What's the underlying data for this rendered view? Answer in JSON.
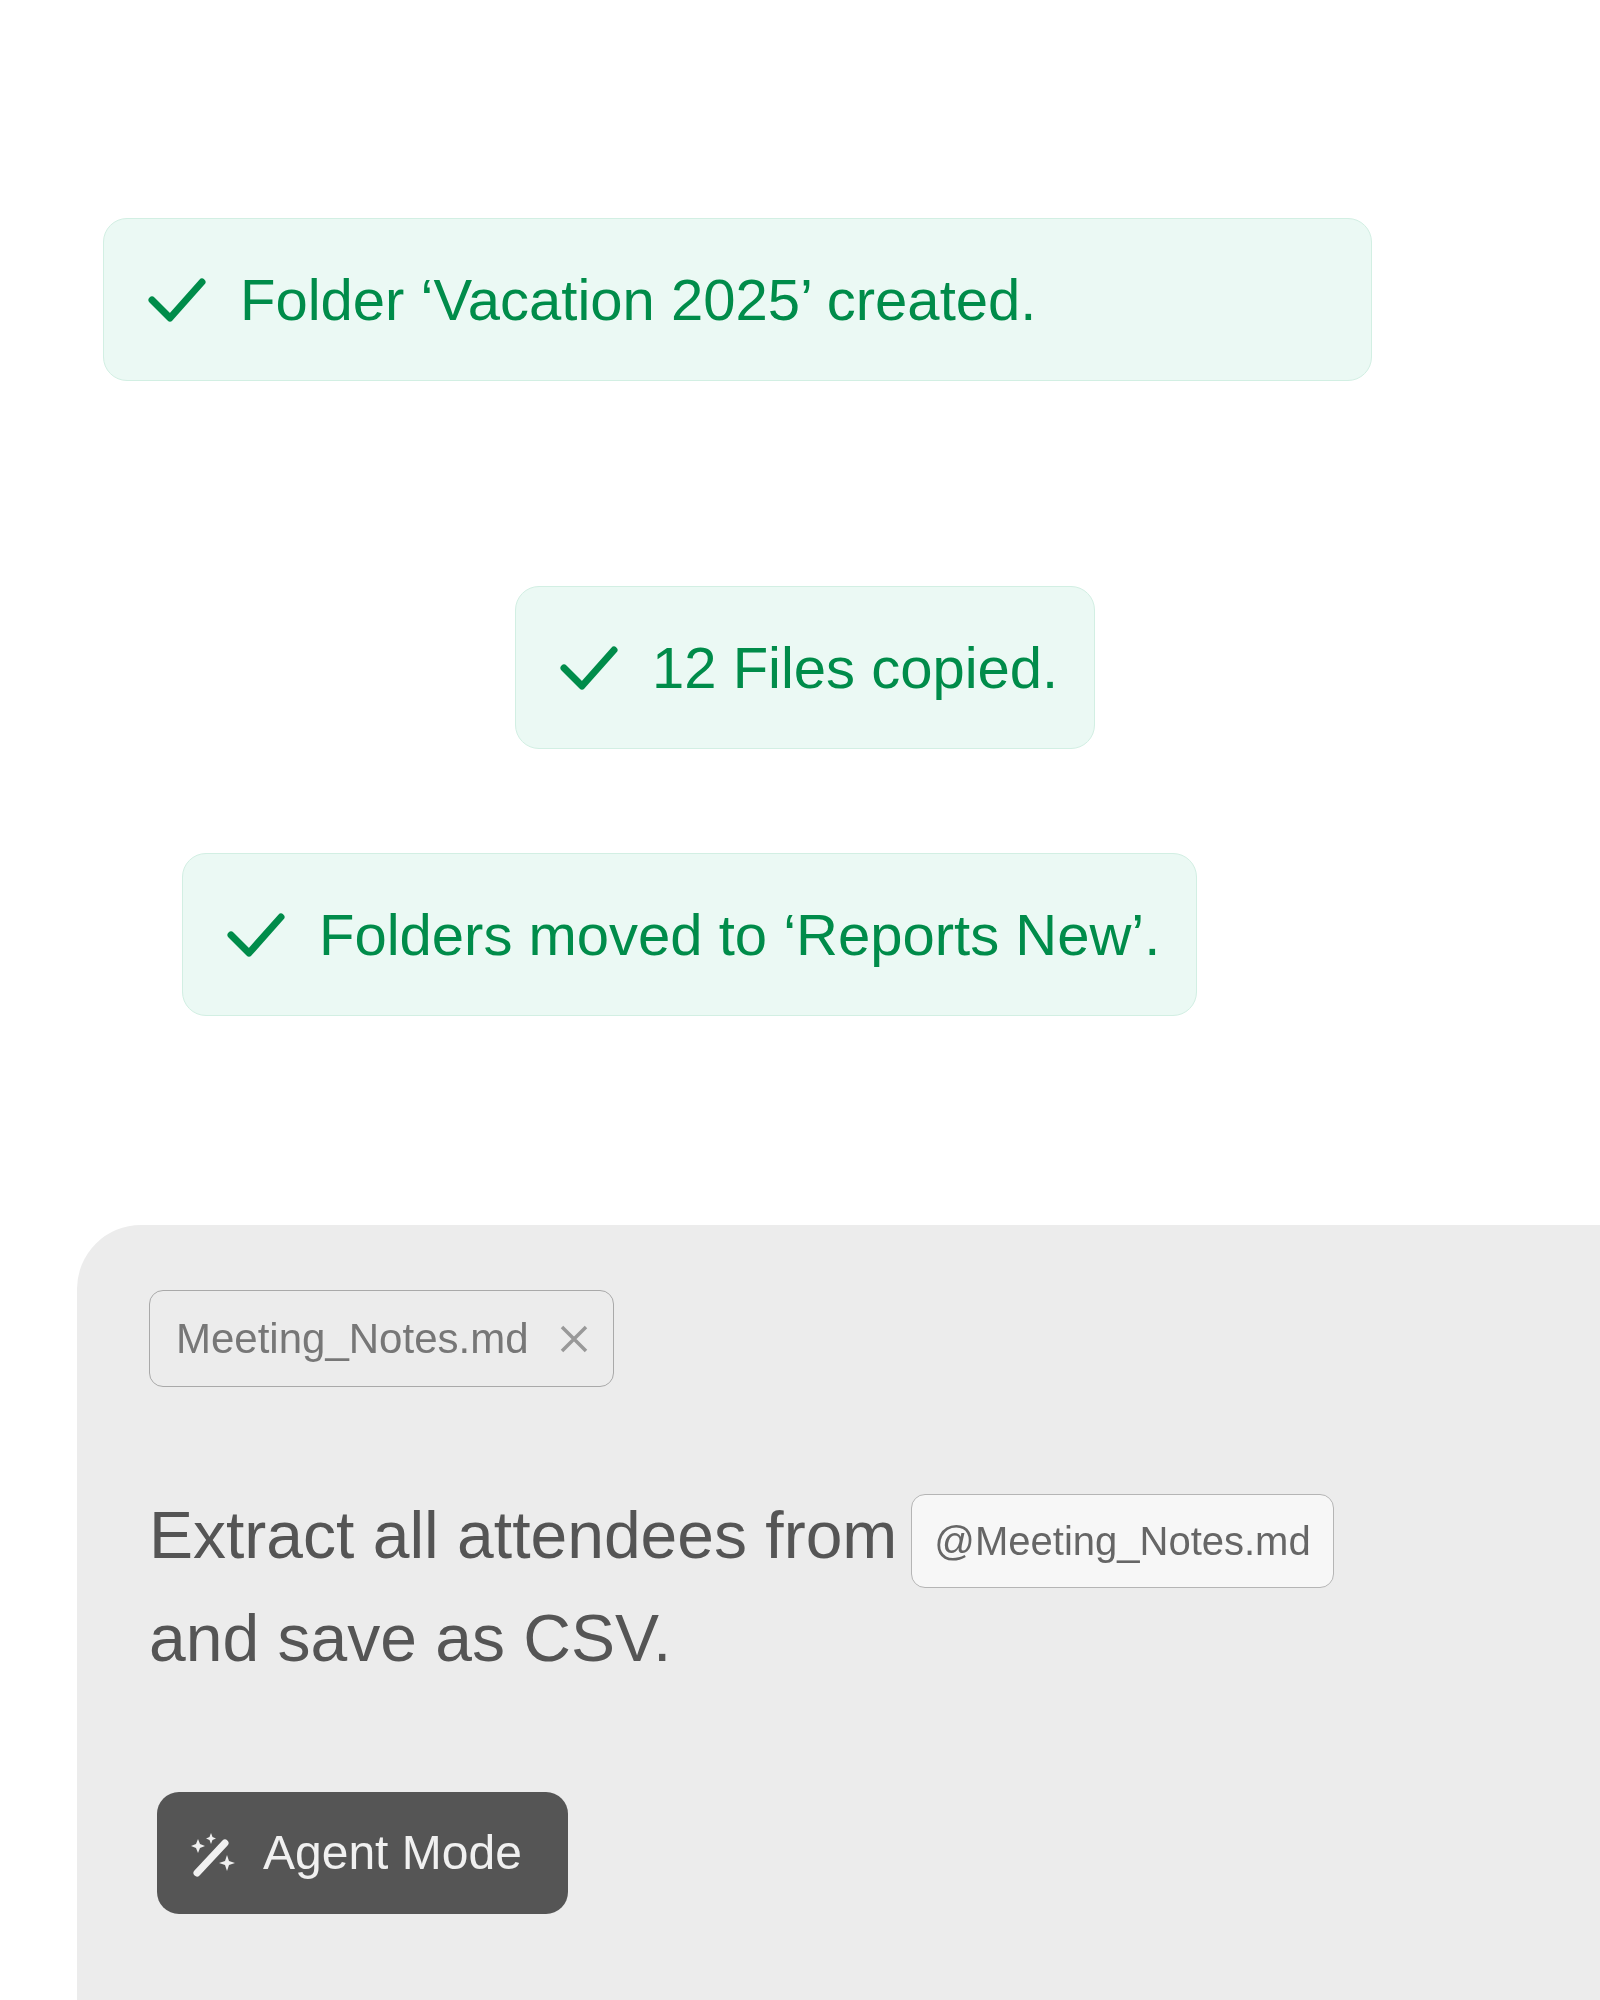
{
  "toasts": [
    {
      "kind": "success",
      "text": "Folder ‘Vacation 2025’ created."
    },
    {
      "kind": "success",
      "text": "12 Files copied."
    },
    {
      "kind": "success",
      "text": "Folders moved to ‘Reports New’."
    }
  ],
  "composer": {
    "attachment": {
      "label": "Meeting_Notes.md"
    },
    "prompt": {
      "before": "Extract all attendees from",
      "mention": "@Meeting_Notes.md",
      "after": "and save as CSV."
    },
    "mode_button": {
      "label": "Agent Mode"
    }
  }
}
